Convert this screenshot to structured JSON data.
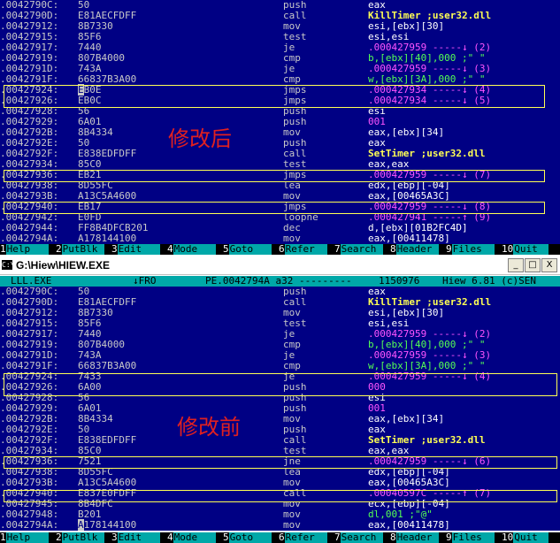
{
  "top_view": {
    "annotation": "修改后",
    "lines": [
      {
        "addr": ".0042790C:",
        "hex": "50",
        "mn": "push",
        "op": "eax",
        "op_style": "white"
      },
      {
        "addr": ".0042790D:",
        "hex": "E81AECFDFF",
        "mn": "call",
        "op": "KillTimer ;user32.dll",
        "op_style": "yellow"
      },
      {
        "addr": ".00427912:",
        "hex": "8B7330",
        "mn": "mov",
        "op": "esi,[ebx][30]",
        "op_style": "white"
      },
      {
        "addr": ".00427915:",
        "hex": "85F6",
        "mn": "test",
        "op": "esi,esi",
        "op_style": "white"
      },
      {
        "addr": ".00427917:",
        "hex": "7440",
        "mn": "je",
        "op": ".000427959 -----↓ (2)",
        "op_style": "magenta"
      },
      {
        "addr": ".00427919:",
        "hex": "807B4000",
        "mn": "cmp",
        "op": "b,[ebx][40],000 ;\" \"",
        "op_style": "green"
      },
      {
        "addr": ".0042791D:",
        "hex": "743A",
        "mn": "je",
        "op": ".000427959 -----↓ (3)",
        "op_style": "magenta"
      },
      {
        "addr": ".0042791F:",
        "hex": "66837B3A00",
        "mn": "cmp",
        "op": "w,[ebx][3A],000 ;\" \"",
        "op_style": "green"
      },
      {
        "addr": ".00427924:",
        "hex": "EB0E",
        "mn": "jmps",
        "op": ".000427934 -----↓ (4)",
        "op_style": "magenta",
        "cursor": true
      },
      {
        "addr": ".00427926:",
        "hex": "EB0C",
        "mn": "jmps",
        "op": ".000427934 -----↓ (5)",
        "op_style": "magenta"
      },
      {
        "addr": ".00427928:",
        "hex": "56",
        "mn": "push",
        "op": "esi",
        "op_style": "white"
      },
      {
        "addr": ".00427929:",
        "hex": "6A01",
        "mn": "push",
        "op": "001",
        "op_style": "magenta"
      },
      {
        "addr": ".0042792B:",
        "hex": "8B4334",
        "mn": "mov",
        "op": "eax,[ebx][34]",
        "op_style": "white"
      },
      {
        "addr": ".0042792E:",
        "hex": "50",
        "mn": "push",
        "op": "eax",
        "op_style": "white"
      },
      {
        "addr": ".0042792F:",
        "hex": "E838EDFDFF",
        "mn": "call",
        "op": "SetTimer ;user32.dll",
        "op_style": "yellow"
      },
      {
        "addr": ".00427934:",
        "hex": "85C0",
        "mn": "test",
        "op": "eax,eax",
        "op_style": "white"
      },
      {
        "addr": ".00427936:",
        "hex": "EB21",
        "mn": "jmps",
        "op": ".000427959 -----↓ (7)",
        "op_style": "magenta"
      },
      {
        "addr": ".00427938:",
        "hex": "8D55FC",
        "mn": "lea",
        "op": "edx,[ebp][-04]",
        "op_style": "white"
      },
      {
        "addr": ".0042793B:",
        "hex": "A13C5A4600",
        "mn": "mov",
        "op": "eax,[00465A3C]",
        "op_style": "white"
      },
      {
        "addr": ".00427940:",
        "hex": "EB17",
        "mn": "jmps",
        "op": ".000427959 -----↓ (8)",
        "op_style": "magenta"
      },
      {
        "addr": ".00427942:",
        "hex": "E0FD",
        "mn": "loopne",
        "op": ".000427941 -----↑ (9)",
        "op_style": "magenta"
      },
      {
        "addr": ".00427944:",
        "hex": "FF8B4DFCB201",
        "mn": "dec",
        "op": "d,[ebx][01B2FC4D]",
        "op_style": "white"
      },
      {
        "addr": ".0042794A:",
        "hex": "A178144100",
        "mn": "mov",
        "op": "eax,[00411478]",
        "op_style": "white"
      }
    ]
  },
  "window": {
    "title": "G:\\Hiew\\HIEW.EXE",
    "icon": "C:\\",
    "minimize": "_",
    "maximize": "□",
    "close": "X"
  },
  "status": {
    "file": "LLL.EXE",
    "mode": "↓FRO",
    "pos": "PE.0042794A a32 ---------",
    "size": "1150976",
    "version": "Hiew 6.81 (c)SEN"
  },
  "bottom_view": {
    "annotation": "修改前",
    "lines": [
      {
        "addr": ".0042790C:",
        "hex": "50",
        "mn": "push",
        "op": "eax",
        "op_style": "white"
      },
      {
        "addr": ".0042790D:",
        "hex": "E81AECFDFF",
        "mn": "call",
        "op": "KillTimer ;user32.dll",
        "op_style": "yellow"
      },
      {
        "addr": ".00427912:",
        "hex": "8B7330",
        "mn": "mov",
        "op": "esi,[ebx][30]",
        "op_style": "white"
      },
      {
        "addr": ".00427915:",
        "hex": "85F6",
        "mn": "test",
        "op": "esi,esi",
        "op_style": "white"
      },
      {
        "addr": ".00427917:",
        "hex": "7440",
        "mn": "je",
        "op": ".000427959 -----↓ (2)",
        "op_style": "magenta"
      },
      {
        "addr": ".00427919:",
        "hex": "807B4000",
        "mn": "cmp",
        "op": "b,[ebx][40],000 ;\" \"",
        "op_style": "green"
      },
      {
        "addr": ".0042791D:",
        "hex": "743A",
        "mn": "je",
        "op": ".000427959 -----↓ (3)",
        "op_style": "magenta"
      },
      {
        "addr": ".0042791F:",
        "hex": "66837B3A00",
        "mn": "cmp",
        "op": "w,[ebx][3A],000 ;\" \"",
        "op_style": "green"
      },
      {
        "addr": ".00427924:",
        "hex": "7433",
        "mn": "je",
        "op": ".000427959 -----↓ (4)",
        "op_style": "magenta"
      },
      {
        "addr": ".00427926:",
        "hex": "6A00",
        "mn": "push",
        "op": "000",
        "op_style": "magenta"
      },
      {
        "addr": ".00427928:",
        "hex": "56",
        "mn": "push",
        "op": "esi",
        "op_style": "white"
      },
      {
        "addr": ".00427929:",
        "hex": "6A01",
        "mn": "push",
        "op": "001",
        "op_style": "magenta"
      },
      {
        "addr": ".0042792B:",
        "hex": "8B4334",
        "mn": "mov",
        "op": "eax,[ebx][34]",
        "op_style": "white"
      },
      {
        "addr": ".0042792E:",
        "hex": "50",
        "mn": "push",
        "op": "eax",
        "op_style": "white"
      },
      {
        "addr": ".0042792F:",
        "hex": "E838EDFDFF",
        "mn": "call",
        "op": "SetTimer ;user32.dll",
        "op_style": "yellow"
      },
      {
        "addr": ".00427934:",
        "hex": "85C0",
        "mn": "test",
        "op": "eax,eax",
        "op_style": "white"
      },
      {
        "addr": ".00427936:",
        "hex": "7521",
        "mn": "jne",
        "op": ".000427959 -----↓ (6)",
        "op_style": "magenta"
      },
      {
        "addr": ".00427938:",
        "hex": "8D55FC",
        "mn": "lea",
        "op": "edx,[ebp][-04]",
        "op_style": "white"
      },
      {
        "addr": ".0042793B:",
        "hex": "A13C5A4600",
        "mn": "mov",
        "op": "eax,[00465A3C]",
        "op_style": "white"
      },
      {
        "addr": ".00427940:",
        "hex": "E837E0FDFF",
        "mn": "call",
        "op": ".00040597C -----↑ (7)",
        "op_style": "magenta"
      },
      {
        "addr": ".00427945:",
        "hex": "8B4DFC",
        "mn": "mov",
        "op": "ecx,[ebp][-04]",
        "op_style": "white"
      },
      {
        "addr": ".00427948:",
        "hex": "B201",
        "mn": "mov",
        "op": "dl,001 ;\"@\"",
        "op_style": "green"
      },
      {
        "addr": ".0042794A:",
        "hex": "A178144100",
        "mn": "mov",
        "op": "eax,[00411478]",
        "op_style": "white",
        "cursor": true
      }
    ]
  },
  "function_keys": [
    {
      "num": "1",
      "label": "Help"
    },
    {
      "num": "2",
      "label": "PutBlk"
    },
    {
      "num": "3",
      "label": "Edit"
    },
    {
      "num": "4",
      "label": "Mode"
    },
    {
      "num": "5",
      "label": "Goto"
    },
    {
      "num": "6",
      "label": "Refer"
    },
    {
      "num": "7",
      "label": "Search"
    },
    {
      "num": "8",
      "label": "Header"
    },
    {
      "num": "9",
      "label": "Files"
    },
    {
      "num": "10",
      "label": "Quit"
    }
  ],
  "colors": {
    "background": "#000084",
    "highlight_box": "#ffff54",
    "annotation": "#e02020",
    "fnkey": "#00a8a8"
  }
}
